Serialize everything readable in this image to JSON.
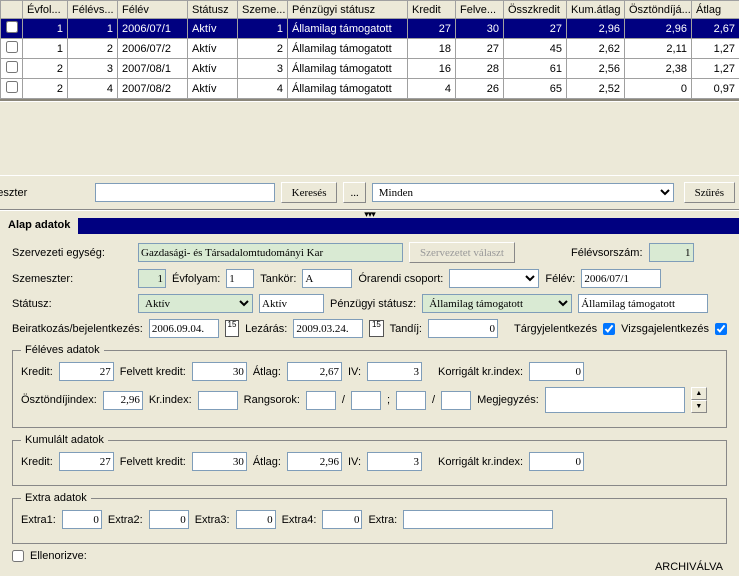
{
  "grid": {
    "headers": [
      "",
      "Évfol...",
      "Félévs...",
      "Félév",
      "Státusz",
      "Szeme...",
      "Pénzügyi státusz",
      "Kredit",
      "Felve...",
      "Összkredit",
      "Kum.átlag",
      "Ösztöndíjá...",
      "Átlag"
    ],
    "rows": [
      {
        "sel": true,
        "c": [
          "1",
          "1",
          "2006/07/1",
          "Aktív",
          "1",
          "Államilag támogatott",
          "27",
          "30",
          "27",
          "2,96",
          "2,96",
          "2,67"
        ]
      },
      {
        "sel": false,
        "c": [
          "1",
          "2",
          "2006/07/2",
          "Aktív",
          "2",
          "Államilag támogatott",
          "18",
          "27",
          "45",
          "2,62",
          "2,11",
          "1,27"
        ]
      },
      {
        "sel": false,
        "c": [
          "2",
          "3",
          "2007/08/1",
          "Aktív",
          "3",
          "Államilag támogatott",
          "16",
          "28",
          "61",
          "2,56",
          "2,38",
          "1,27"
        ]
      },
      {
        "sel": false,
        "c": [
          "2",
          "4",
          "2007/08/2",
          "Aktív",
          "4",
          "Államilag támogatott",
          "4",
          "26",
          "65",
          "2,52",
          "0",
          "0,97"
        ]
      }
    ]
  },
  "midbar": {
    "leftlabel": "emeszter",
    "search": "Keresés",
    "dots": "...",
    "combo": "Minden",
    "filter": "Szűrés"
  },
  "tab": "Alap adatok",
  "form": {
    "org_lbl": "Szervezeti egység:",
    "org": "Gazdasági- és Társadalomtudományi Kar",
    "org_btn": "Szervezetet választ",
    "semorder_lbl": "Félévsorszám:",
    "semorder": "1",
    "sem_lbl": "Szemeszter:",
    "sem": "1",
    "year_lbl": "Évfolyam:",
    "year": "1",
    "tank_lbl": "Tankör:",
    "tank": "A",
    "grp_lbl": "Órarendi csoport:",
    "term_lbl": "Félév:",
    "term": "2006/07/1",
    "status_lbl": "Státusz:",
    "status": "Aktív",
    "status2": "Aktív",
    "fin_lbl": "Pénzügyi státusz:",
    "fin": "Államilag támogatott",
    "fin2": "Államilag támogatott",
    "enroll_lbl": "Beiratkozás/bejelentkezés:",
    "enroll": "2006.09.04.",
    "close_lbl": "Lezárás:",
    "close": "2009.03.24.",
    "fee_lbl": "Tandíj:",
    "fee": "0",
    "subj_lbl": "Tárgyjelentkezés",
    "exam_lbl": "Vizsgajelentkezés"
  },
  "feleves": {
    "legend": "Féléves adatok",
    "kredit_lbl": "Kredit:",
    "kredit": "27",
    "fkredit_lbl": "Felvett kredit:",
    "fkredit": "30",
    "atlag_lbl": "Átlag:",
    "atlag": "2,67",
    "iv_lbl": "IV:",
    "iv": "3",
    "korr_lbl": "Korrigált kr.index:",
    "korr": "0",
    "osz_lbl": "Ösztöndíjindex:",
    "osz": "2,96",
    "kri_lbl": "Kr.index:",
    "rang_lbl": "Rangsorok:",
    "meg_lbl": "Megjegyzés:"
  },
  "kum": {
    "legend": "Kumulált adatok",
    "kredit_lbl": "Kredit:",
    "kredit": "27",
    "fkredit_lbl": "Felvett kredit:",
    "fkredit": "30",
    "atlag_lbl": "Átlag:",
    "atlag": "2,96",
    "iv_lbl": "IV:",
    "iv": "3",
    "korr_lbl": "Korrigált kr.index:",
    "korr": "0"
  },
  "extra": {
    "legend": "Extra adatok",
    "e1_lbl": "Extra1:",
    "e1": "0",
    "e2_lbl": "Extra2:",
    "e2": "0",
    "e3_lbl": "Extra3:",
    "e3": "0",
    "e4_lbl": "Extra4:",
    "e4": "0",
    "e_lbl": "Extra:"
  },
  "ellen": "Ellenorizve:",
  "arch": "ARCHIVÁLVA"
}
